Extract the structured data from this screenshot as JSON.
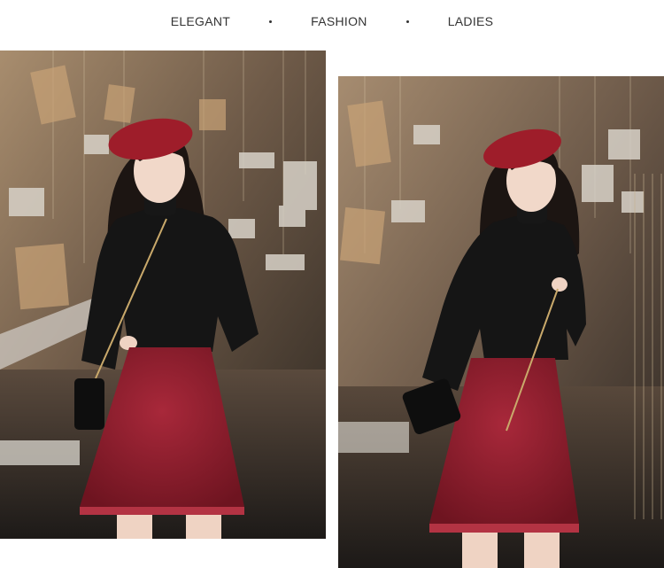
{
  "header": {
    "words": [
      "ELEGANT",
      "FASHION",
      "LADIES"
    ]
  },
  "photos": [
    {
      "subject": "photo-left"
    },
    {
      "subject": "photo-right"
    }
  ],
  "colors": {
    "beret": "#9e1d2a",
    "sweater": "#141414",
    "skirt": "#8f1b28",
    "background_warm": "#b99a78",
    "background_dark": "#3a2e26"
  }
}
